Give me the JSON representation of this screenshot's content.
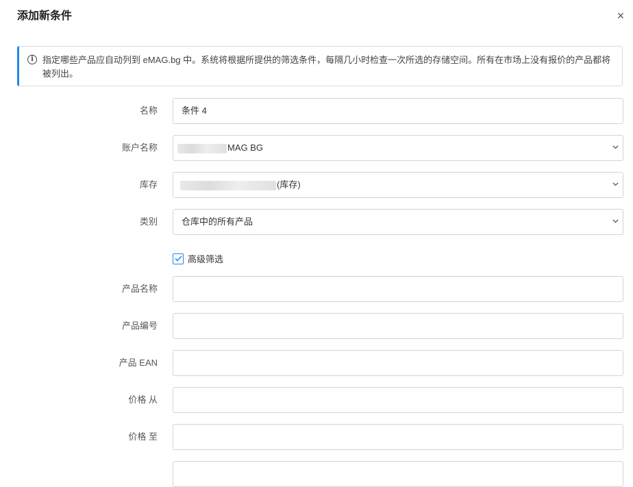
{
  "dialog": {
    "title": "添加新条件",
    "close_label": "×"
  },
  "info": {
    "icon": "info-icon",
    "text": "指定哪些产品应自动列到 eMAG.bg 中。系统将根据所提供的筛选条件，每隔几小时检查一次所选的存储空间。所有在市场上没有报价的产品都将被列出。"
  },
  "form": {
    "name": {
      "label": "名称",
      "value": "条件 4"
    },
    "account": {
      "label": "账户名称",
      "value": "MAG BG"
    },
    "inventory": {
      "label": "库存",
      "value": "(库存)"
    },
    "category": {
      "label": "类别",
      "value": "仓库中的所有产品"
    },
    "advanced_filter": {
      "label": "高级筛选",
      "checked": true
    },
    "product_name": {
      "label": "产品名称",
      "value": ""
    },
    "product_code": {
      "label": "产品编号",
      "value": ""
    },
    "product_ean": {
      "label": "产品 EAN",
      "value": ""
    },
    "price_from": {
      "label": "价格 从",
      "value": ""
    },
    "price_to": {
      "label": "价格 至",
      "value": ""
    }
  },
  "colors": {
    "accent": "#1e88e5",
    "border": "#d4d4d4"
  }
}
